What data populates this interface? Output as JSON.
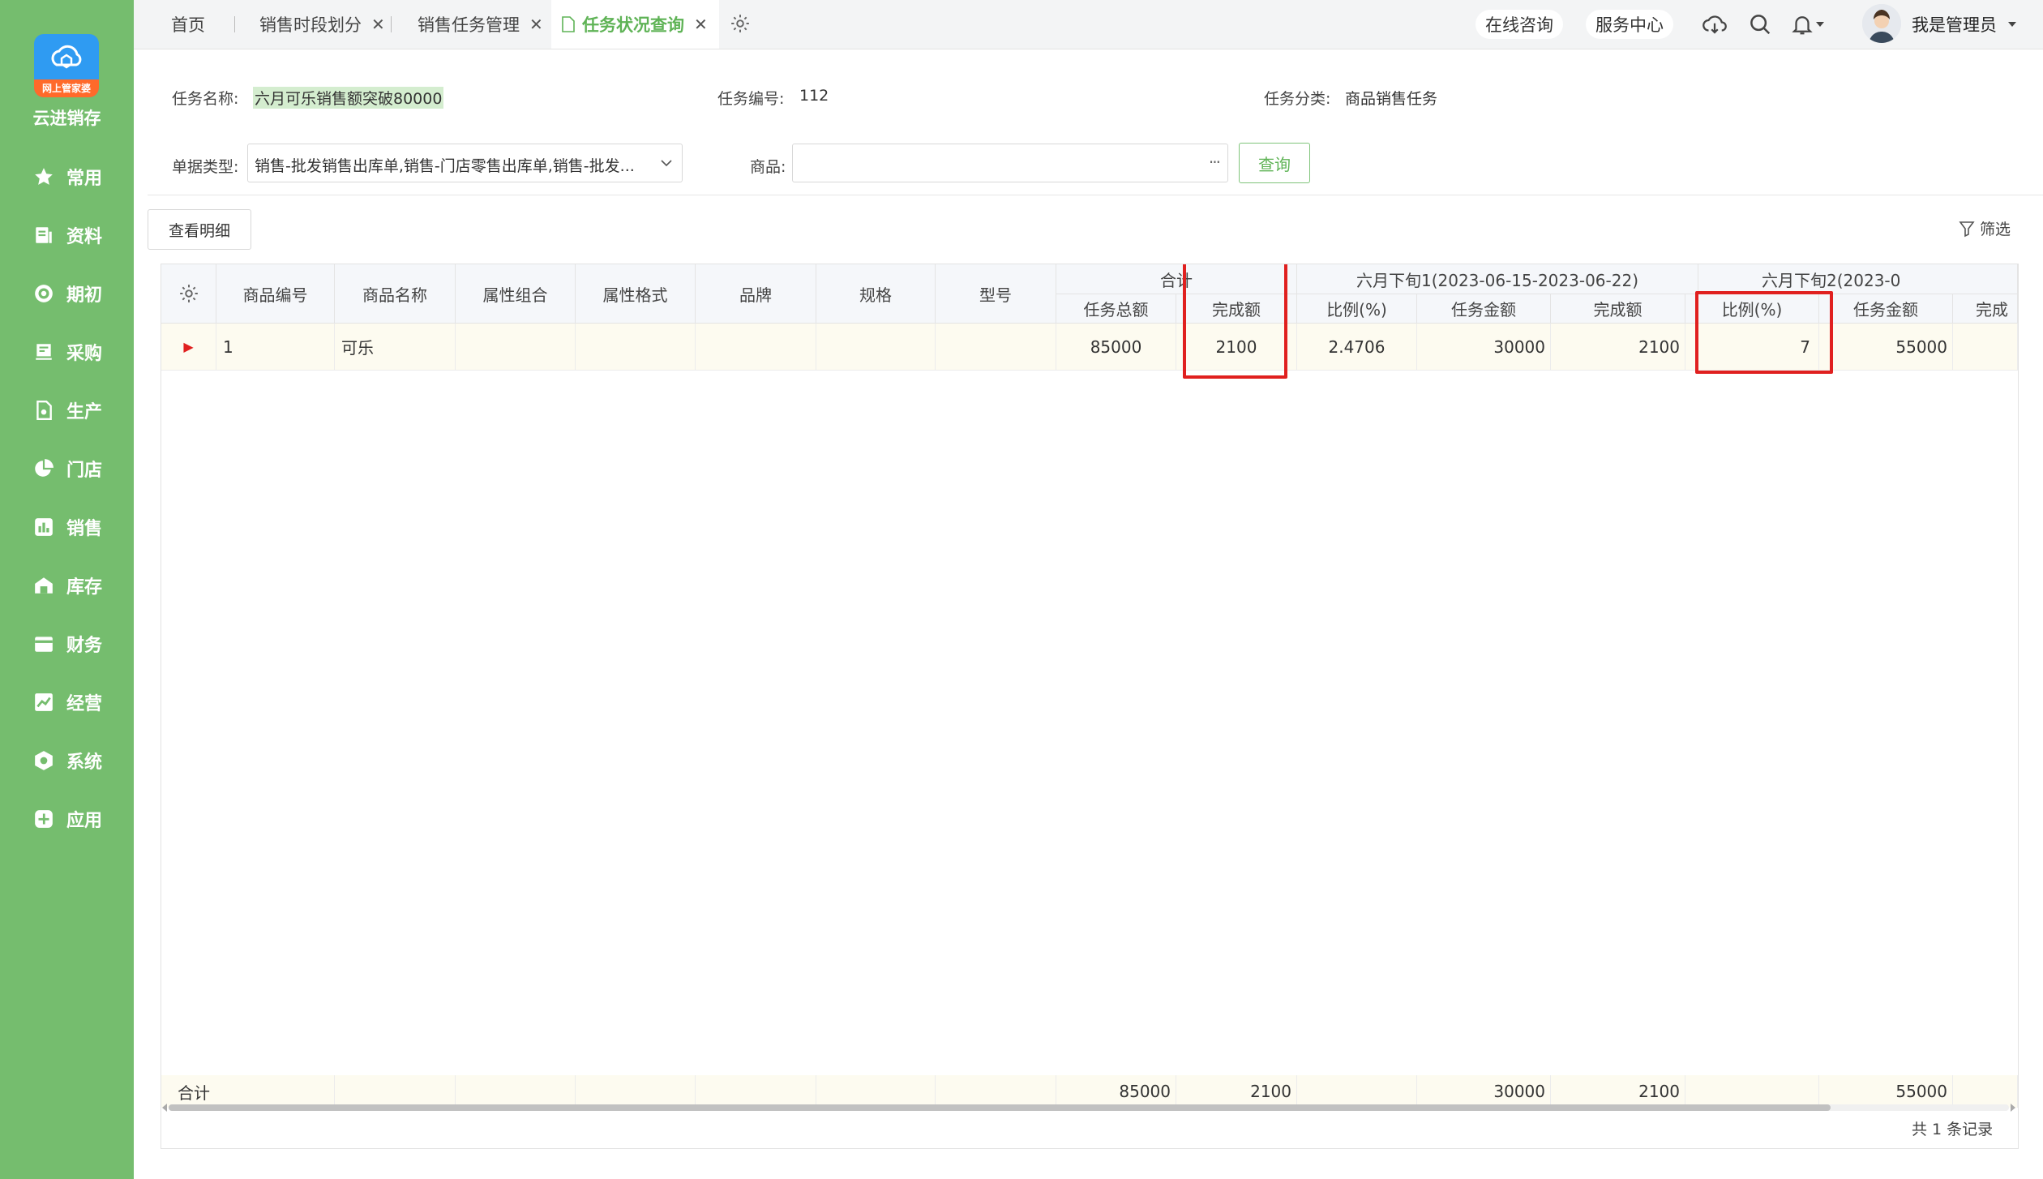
{
  "app": {
    "name": "云进销存",
    "logo_ribbon": "网上管家婆",
    "brand_color": "#75bd6e",
    "accent": "#5fb356"
  },
  "sidebar": {
    "items": [
      {
        "label": "常用",
        "icon": "star-icon"
      },
      {
        "label": "资料",
        "icon": "document-icon"
      },
      {
        "label": "期初",
        "icon": "target-icon"
      },
      {
        "label": "采购",
        "icon": "cart-icon"
      },
      {
        "label": "生产",
        "icon": "file-cog-icon"
      },
      {
        "label": "门店",
        "icon": "pie-icon"
      },
      {
        "label": "销售",
        "icon": "bar-chart-icon"
      },
      {
        "label": "库存",
        "icon": "warehouse-icon"
      },
      {
        "label": "财务",
        "icon": "wallet-icon"
      },
      {
        "label": "经营",
        "icon": "trend-icon"
      },
      {
        "label": "系统",
        "icon": "hexagon-icon"
      },
      {
        "label": "应用",
        "icon": "plus-icon"
      }
    ]
  },
  "tabs": [
    {
      "label": "首页"
    },
    {
      "label": "销售时段划分"
    },
    {
      "label": "销售任务管理"
    },
    {
      "label": "任务状况查询"
    }
  ],
  "topbar": {
    "consult": "在线咨询",
    "service": "服务中心",
    "user": "我是管理员"
  },
  "form": {
    "task_name_label": "任务名称:",
    "task_name": "六月可乐销售额突破80000",
    "task_no_label": "任务编号:",
    "task_no": "112",
    "task_category_label": "任务分类:",
    "task_category": "商品销售任务",
    "doc_type_label": "单据类型:",
    "doc_type": "销售-批发销售出库单,销售-门店零售出库单,销售-批发...",
    "product_label": "商品:",
    "product_value": "",
    "product_more": "···",
    "query_label": "查询"
  },
  "toolbar": {
    "detail_label": "查看明细",
    "filter_label": "筛选"
  },
  "grid": {
    "columns": [
      "商品编号",
      "商品名称",
      "属性组合",
      "属性格式",
      "品牌",
      "规格",
      "型号"
    ],
    "group_total": "合计",
    "group_p1": "六月下旬1(2023-06-15-2023-06-22)",
    "group_p2": "六月下旬2(2023-0",
    "sub_total": [
      "任务总额",
      "完成额",
      "比例(%)"
    ],
    "sub_p1": [
      "任务金额",
      "完成额",
      "比例(%)"
    ],
    "sub_p2": [
      "任务金额",
      "完成"
    ],
    "row": {
      "code": "1",
      "name": "可乐",
      "total_task": "85000",
      "total_done": "2100",
      "total_ratio": "2.4706",
      "p1_task": "30000",
      "p1_done": "2100",
      "p1_ratio": "7",
      "p2_task": "55000"
    },
    "footer": {
      "label": "合计",
      "total_task": "85000",
      "total_done": "2100",
      "p1_task": "30000",
      "p1_done": "2100",
      "p2_task": "55000"
    },
    "records": "共 1 条记录"
  }
}
